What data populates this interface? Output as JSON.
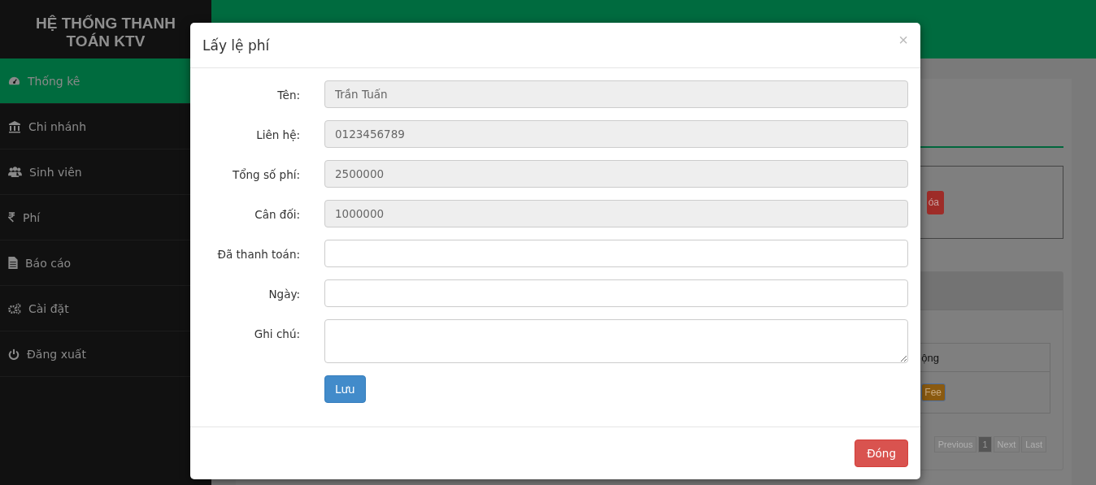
{
  "sidebar": {
    "title": "HỆ THỐNG THANH TOÁN KTV",
    "items": [
      {
        "label": "Thống kê",
        "selected": true
      },
      {
        "label": "Chi nhánh",
        "selected": false
      },
      {
        "label": "Sinh viên",
        "selected": false
      },
      {
        "label": "Phí",
        "selected": false
      },
      {
        "label": "Báo cáo",
        "selected": false
      },
      {
        "label": "Cài đặt",
        "selected": false
      },
      {
        "label": "Đăng xuất",
        "selected": false
      }
    ]
  },
  "background": {
    "delete_button": "óa",
    "table_header": "ộng",
    "fee_button": "Fee",
    "pagination": [
      {
        "label": "Previous",
        "selected": false
      },
      {
        "label": "1",
        "selected": true
      },
      {
        "label": "Next",
        "selected": false
      },
      {
        "label": "Last",
        "selected": false
      }
    ]
  },
  "modal": {
    "title": "Lấy lệ phí",
    "close": "×",
    "fields": [
      {
        "label": "Tên:",
        "kind": "input",
        "value": "Trần Tuấn",
        "disabled": true
      },
      {
        "label": "Liên hệ:",
        "kind": "input",
        "value": "0123456789",
        "disabled": true
      },
      {
        "label": "Tổng số phí:",
        "kind": "input",
        "value": "2500000",
        "disabled": true
      },
      {
        "label": "Cân đối:",
        "kind": "input",
        "value": "1000000",
        "disabled": true
      },
      {
        "label": "Đã thanh toán:",
        "kind": "input",
        "disabled": false
      },
      {
        "label": "Ngày:",
        "kind": "input",
        "disabled": false
      },
      {
        "label": "Ghi chú:",
        "kind": "textarea",
        "disabled": false
      }
    ],
    "save_button": "Lưu",
    "close_button": "Đóng"
  }
}
